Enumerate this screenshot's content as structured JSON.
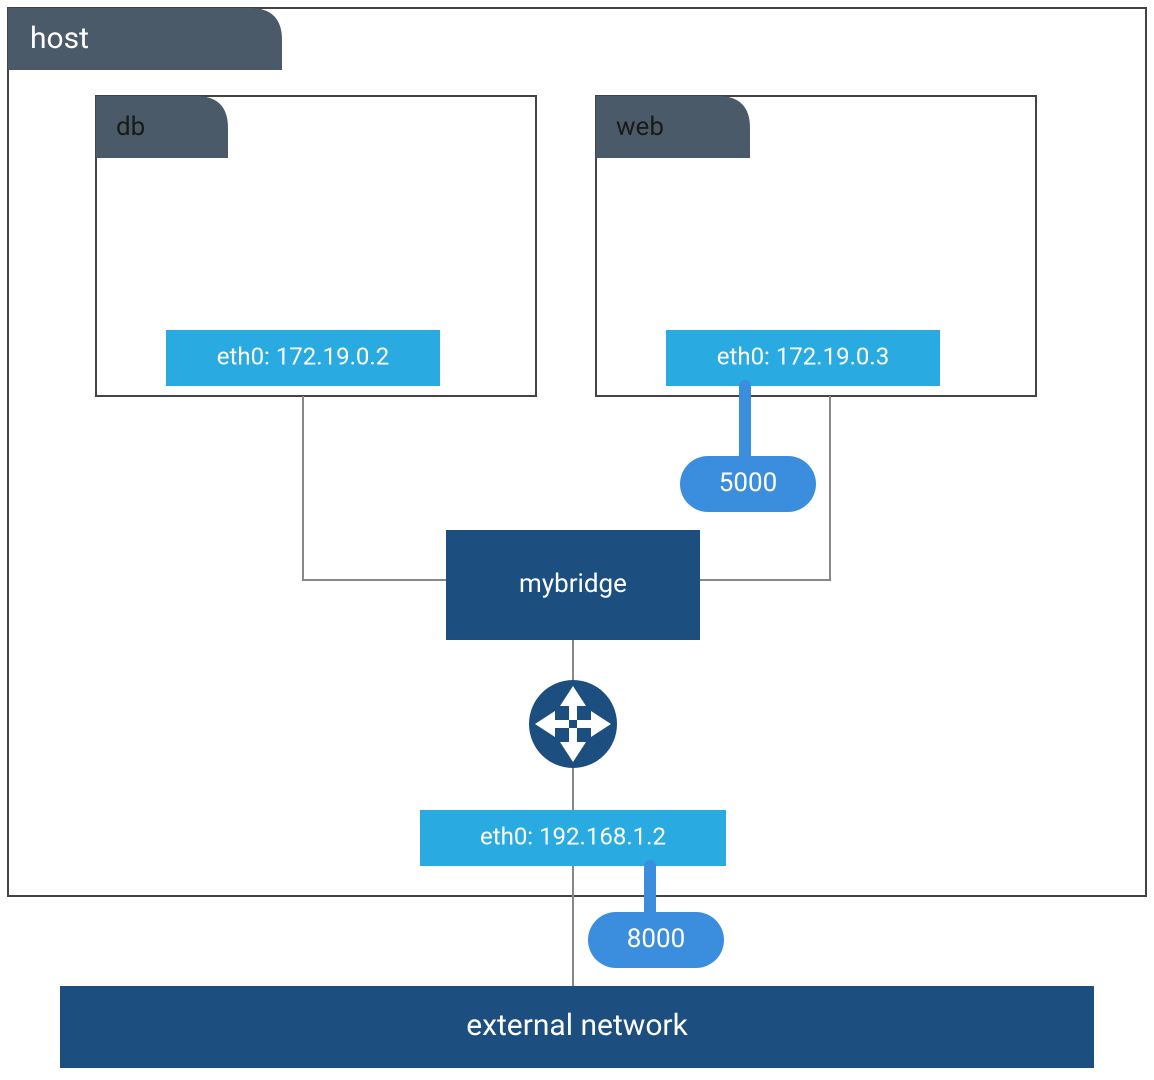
{
  "colors": {
    "slate": "#4a5a68",
    "lightblue": "#29abe2",
    "darkblue": "#1c4e80",
    "midblue": "#3b8ede",
    "gray": "#888888",
    "border": "#444"
  },
  "host": {
    "label": "host"
  },
  "containers": {
    "db": {
      "label": "db",
      "iface": "eth0: 172.19.0.2"
    },
    "web": {
      "label": "web",
      "iface": "eth0: 172.19.0.3",
      "port": "5000"
    }
  },
  "bridge": {
    "label": "mybridge"
  },
  "host_iface": {
    "label": "eth0: 192.168.1.2",
    "port": "8000"
  },
  "external": {
    "label": "external network"
  }
}
